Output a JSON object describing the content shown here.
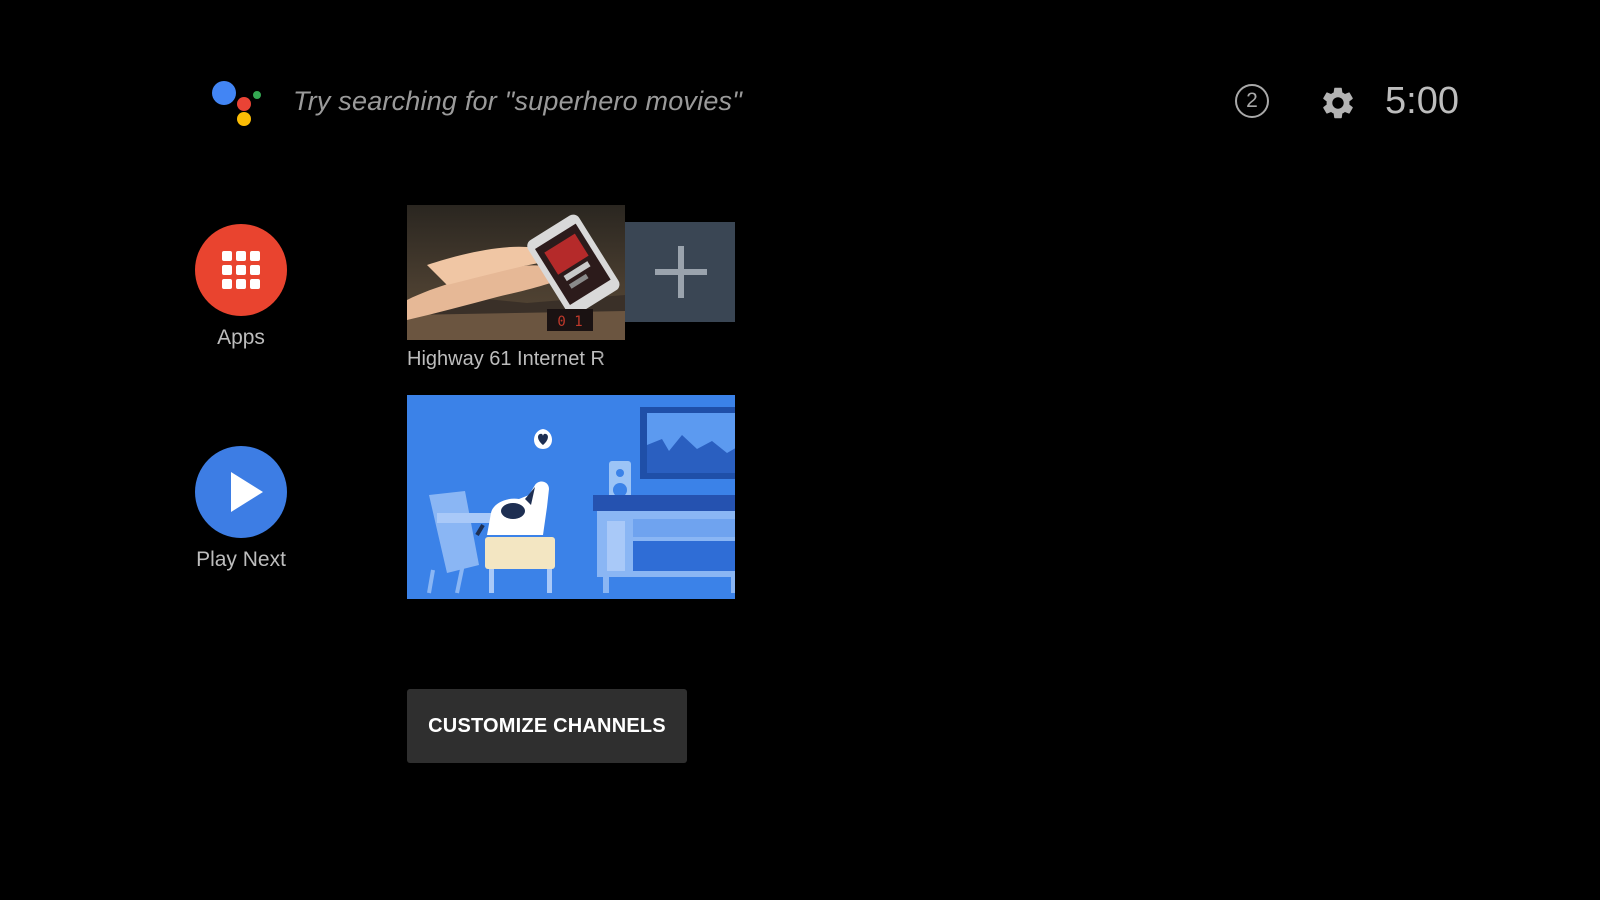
{
  "search": {
    "hint": "Try searching for \"superhero movies\""
  },
  "status": {
    "notification_count": "2",
    "time": "5:00"
  },
  "nav": {
    "apps_label": "Apps",
    "play_next_label": "Play Next"
  },
  "channel": {
    "title": "Highway 61 Internet R"
  },
  "buttons": {
    "customize": "CUSTOMIZE CHANNELS"
  },
  "colors": {
    "background": "#000000",
    "apps_red": "#e9442f",
    "play_next_blue": "#3d7de4",
    "add_tile": "#3a4654",
    "button_bg": "#2f2f2f"
  },
  "icons": {
    "assistant": "google-assistant-icon",
    "notifications": "notification-count-icon",
    "settings": "gear-icon",
    "apps": "apps-grid-icon",
    "play_next": "play-icon",
    "add_channel": "plus-icon"
  }
}
